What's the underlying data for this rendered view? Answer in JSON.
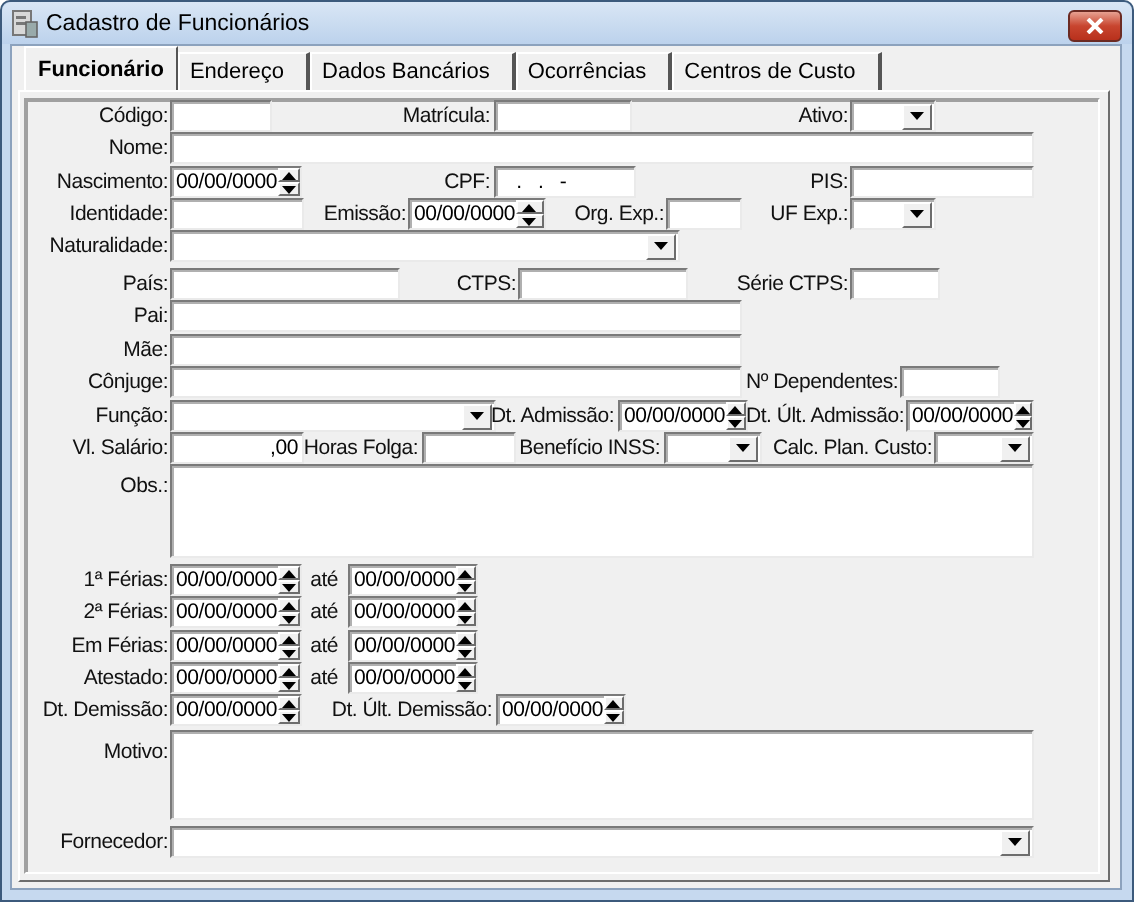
{
  "window": {
    "title": "Cadastro de Funcionários"
  },
  "tabs": [
    {
      "label": "Funcionário",
      "selected": true
    },
    {
      "label": "Endereço",
      "selected": false
    },
    {
      "label": "Dados Bancários",
      "selected": false
    },
    {
      "label": "Ocorrências",
      "selected": false
    },
    {
      "label": "Centros de Custo",
      "selected": false
    }
  ],
  "form": {
    "rows": [
      {
        "fields": [
          {
            "label": "Código:",
            "kind": "text"
          },
          {
            "label": "Matrícula:",
            "kind": "text"
          },
          {
            "label": "Ativo:",
            "kind": "combo"
          }
        ]
      },
      {
        "fields": [
          {
            "label": "Nome:",
            "kind": "text"
          }
        ]
      },
      {
        "fields": [
          {
            "label": "Nascimento:",
            "kind": "date",
            "value": "00/00/0000"
          },
          {
            "label": "CPF:",
            "kind": "text",
            "value": "   .   .   -"
          },
          {
            "label": "PIS:",
            "kind": "text"
          }
        ]
      },
      {
        "fields": [
          {
            "label": "Identidade:",
            "kind": "text"
          },
          {
            "label": "Emissão:",
            "kind": "date",
            "value": "00/00/0000"
          },
          {
            "label": "Org. Exp.:",
            "kind": "text"
          },
          {
            "label": "UF Exp.:",
            "kind": "combo"
          }
        ]
      },
      {
        "fields": [
          {
            "label": "Naturalidade:",
            "kind": "combo"
          }
        ]
      },
      {
        "fields": [
          {
            "label": "País:",
            "kind": "text"
          },
          {
            "label": "CTPS:",
            "kind": "text"
          },
          {
            "label": "Série CTPS:",
            "kind": "text"
          }
        ]
      },
      {
        "fields": [
          {
            "label": "Pai:",
            "kind": "text"
          }
        ]
      },
      {
        "fields": [
          {
            "label": "Mãe:",
            "kind": "text"
          }
        ]
      },
      {
        "fields": [
          {
            "label": "Cônjuge:",
            "kind": "text"
          },
          {
            "label": "Nº Dependentes:",
            "kind": "text"
          }
        ]
      },
      {
        "fields": [
          {
            "label": "Função:",
            "kind": "combo"
          },
          {
            "label": "Dt. Admissão:",
            "kind": "date",
            "value": "00/00/0000"
          },
          {
            "label": "Dt. Últ. Admissão:",
            "kind": "date",
            "value": "00/00/0000"
          }
        ]
      },
      {
        "fields": [
          {
            "label": "Vl. Salário:",
            "kind": "number",
            "value": ",00"
          },
          {
            "label": "Horas Folga:",
            "kind": "text"
          },
          {
            "label": "Benefício INSS:",
            "kind": "combo"
          },
          {
            "label": "Calc. Plan. Custo:",
            "kind": "combo"
          }
        ]
      },
      {
        "fields": [
          {
            "label": "Obs.:",
            "kind": "memo"
          }
        ]
      },
      {
        "fields": [
          {
            "label": "1ª Férias:",
            "kind": "date",
            "value": "00/00/0000"
          },
          {
            "label": "até",
            "kind": "date",
            "value": "00/00/0000"
          }
        ]
      },
      {
        "fields": [
          {
            "label": "2ª Férias:",
            "kind": "date",
            "value": "00/00/0000"
          },
          {
            "label": "até",
            "kind": "date",
            "value": "00/00/0000"
          }
        ]
      },
      {
        "fields": [
          {
            "label": "Em Férias:",
            "kind": "date",
            "value": "00/00/0000"
          },
          {
            "label": "até",
            "kind": "date",
            "value": "00/00/0000"
          }
        ]
      },
      {
        "fields": [
          {
            "label": "Atestado:",
            "kind": "date",
            "value": "00/00/0000"
          },
          {
            "label": "até",
            "kind": "date",
            "value": "00/00/0000"
          }
        ]
      },
      {
        "fields": [
          {
            "label": "Dt. Demissão:",
            "kind": "date",
            "value": "00/00/0000"
          },
          {
            "label": "Dt. Últ. Demissão:",
            "kind": "date",
            "value": "00/00/0000"
          }
        ]
      },
      {
        "fields": [
          {
            "label": "Motivo:",
            "kind": "memo"
          }
        ]
      },
      {
        "fields": [
          {
            "label": "Fornecedor:",
            "kind": "combo"
          }
        ]
      }
    ]
  }
}
